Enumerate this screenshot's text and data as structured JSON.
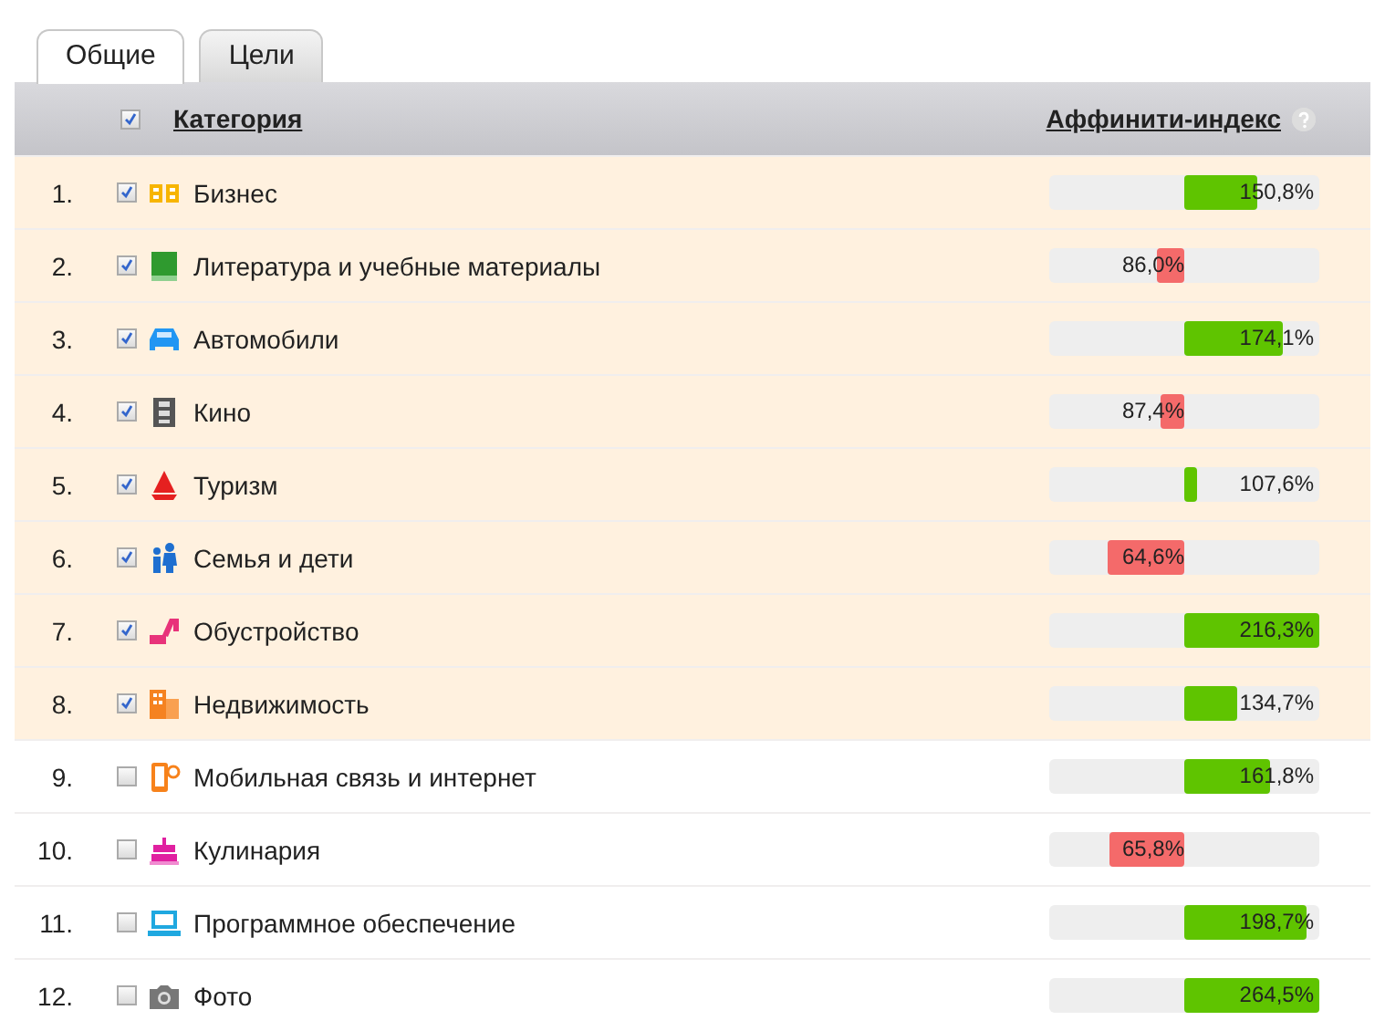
{
  "tabs": [
    {
      "label": "Общие",
      "selected": true
    },
    {
      "label": "Цели",
      "selected": false
    }
  ],
  "table": {
    "header": {
      "checked": true,
      "category": "Категория",
      "index": "Аффинити-индекс"
    },
    "rows": [
      {
        "number": "1.",
        "checked": true,
        "name": "Бизнес",
        "kind": "above",
        "value": "150,8%"
      },
      {
        "number": "2.",
        "checked": true,
        "name": "Литература и учебные материалы",
        "kind": "below",
        "value": "86,0%"
      },
      {
        "number": "3.",
        "checked": true,
        "name": "Автомобили",
        "kind": "above",
        "value": "174,1%"
      },
      {
        "number": "4.",
        "checked": true,
        "name": "Кино",
        "kind": "below",
        "value": "87,4%"
      },
      {
        "number": "5.",
        "checked": true,
        "name": "Туризм",
        "kind": "above",
        "value": "107,6%"
      },
      {
        "number": "6.",
        "checked": true,
        "name": "Семья и дети",
        "kind": "below",
        "value": "64,6%"
      },
      {
        "number": "7.",
        "checked": true,
        "name": "Обустройство",
        "kind": "above",
        "value": "216,3%"
      },
      {
        "number": "8.",
        "checked": true,
        "name": "Недвижимость",
        "kind": "above",
        "value": "134,7%"
      },
      {
        "number": "9.",
        "checked": false,
        "name": "Мобильная связь и интернет",
        "kind": "above",
        "value": "161,8%"
      },
      {
        "number": "10.",
        "checked": false,
        "name": "Кулинария",
        "kind": "below",
        "value": "65,8%"
      },
      {
        "number": "11.",
        "checked": false,
        "name": "Программное обеспечение",
        "kind": "above",
        "value": "198,7%"
      },
      {
        "number": "12.",
        "checked": false,
        "name": "Фото",
        "kind": "above",
        "value": "264,5%"
      }
    ]
  }
}
